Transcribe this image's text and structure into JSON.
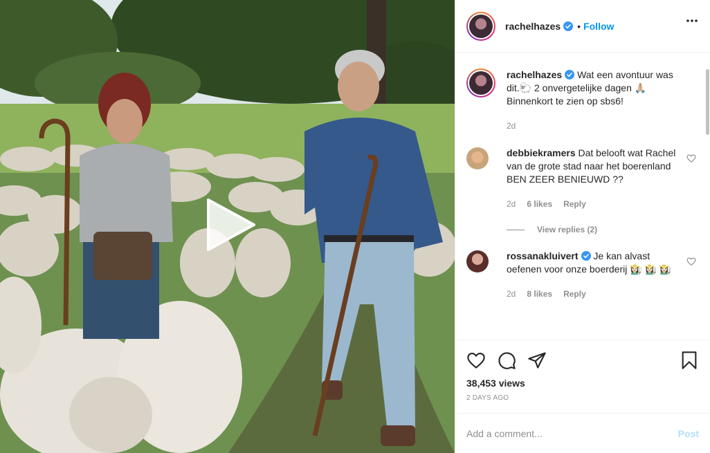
{
  "post": {
    "username": "rachelhazes",
    "follow_label": "Follow",
    "dot": "•",
    "more_icon": "more-options-icon",
    "caption": {
      "username": "rachelhazes",
      "text": "Wat een avontuur was dit.🐑 2 onvergetelijke dagen 🙏🏼 Binnenkort te zien op sbs6!",
      "time": "2d"
    },
    "comments": [
      {
        "username": "debbiekramers",
        "text": "Dat belooft wat Rachel van de grote stad naar het boerenland BEN ZEER BENIEUWD ??",
        "time": "2d",
        "likes": "6 likes",
        "reply_label": "Reply",
        "view_replies": "View replies (2)",
        "verified": false
      },
      {
        "username": "rossanakluivert",
        "text": "Je kan alvast oefenen voor onze boerderij 👩🏻‍🌾 👩🏻‍🌾 👩🏻‍🌾",
        "time": "2d",
        "likes": "8 likes",
        "reply_label": "Reply",
        "verified": true
      }
    ],
    "views": "38,453 views",
    "posted": "2 DAYS AGO",
    "add_comment_placeholder": "Add a comment...",
    "post_label": "Post"
  },
  "colors": {
    "link": "#0095f6",
    "muted": "#8e8e8e",
    "post_disabled": "#b2dffc"
  },
  "icons": [
    "heart-icon",
    "comment-icon",
    "share-icon",
    "bookmark-icon",
    "verified-icon",
    "play-icon"
  ]
}
